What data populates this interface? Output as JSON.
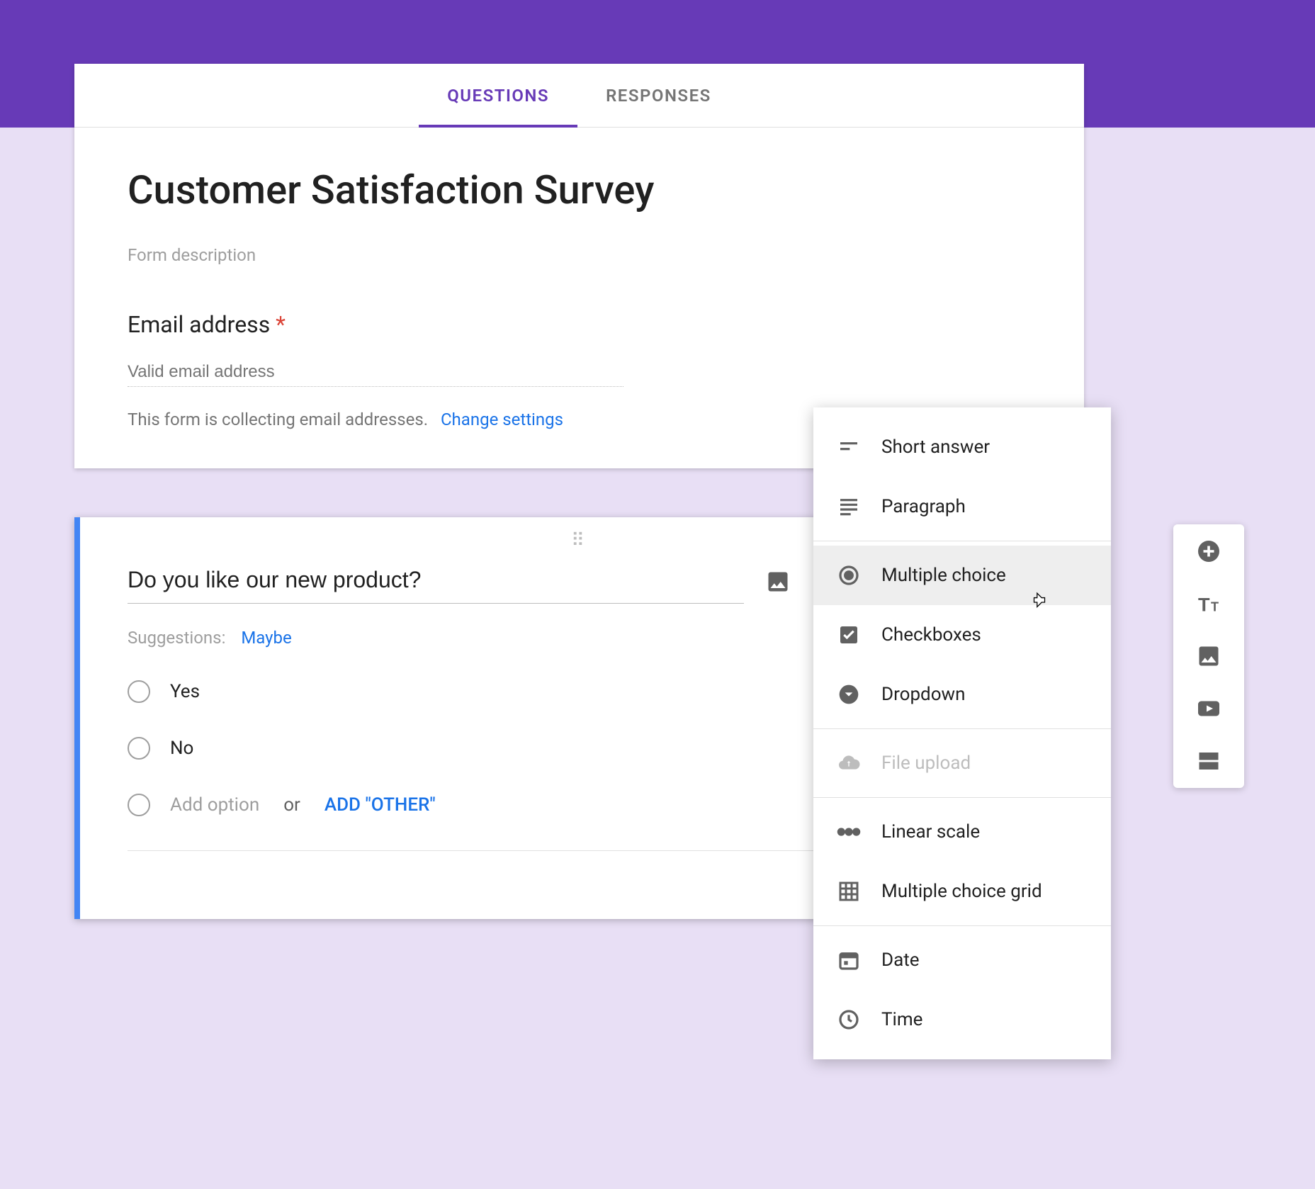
{
  "tabs": {
    "questions": "QUESTIONS",
    "responses": "RESPONSES"
  },
  "header": {
    "title": "Customer Satisfaction Survey",
    "description": "Form description",
    "email_label": "Email address",
    "required_mark": "*",
    "email_placeholder": "Valid email address",
    "collecting_note": "This form is collecting email addresses.",
    "change_settings": "Change settings"
  },
  "question": {
    "text": "Do you like our new product?",
    "suggestions_label": "Suggestions:",
    "suggestion1": "Maybe",
    "options": [
      "Yes",
      "No"
    ],
    "add_option": "Add option",
    "or": "or",
    "add_other": "ADD \"OTHER\""
  },
  "type_menu": {
    "short_answer": "Short answer",
    "paragraph": "Paragraph",
    "multiple_choice": "Multiple choice",
    "checkboxes": "Checkboxes",
    "dropdown": "Dropdown",
    "file_upload": "File upload",
    "linear_scale": "Linear scale",
    "mc_grid": "Multiple choice grid",
    "date": "Date",
    "time": "Time"
  }
}
